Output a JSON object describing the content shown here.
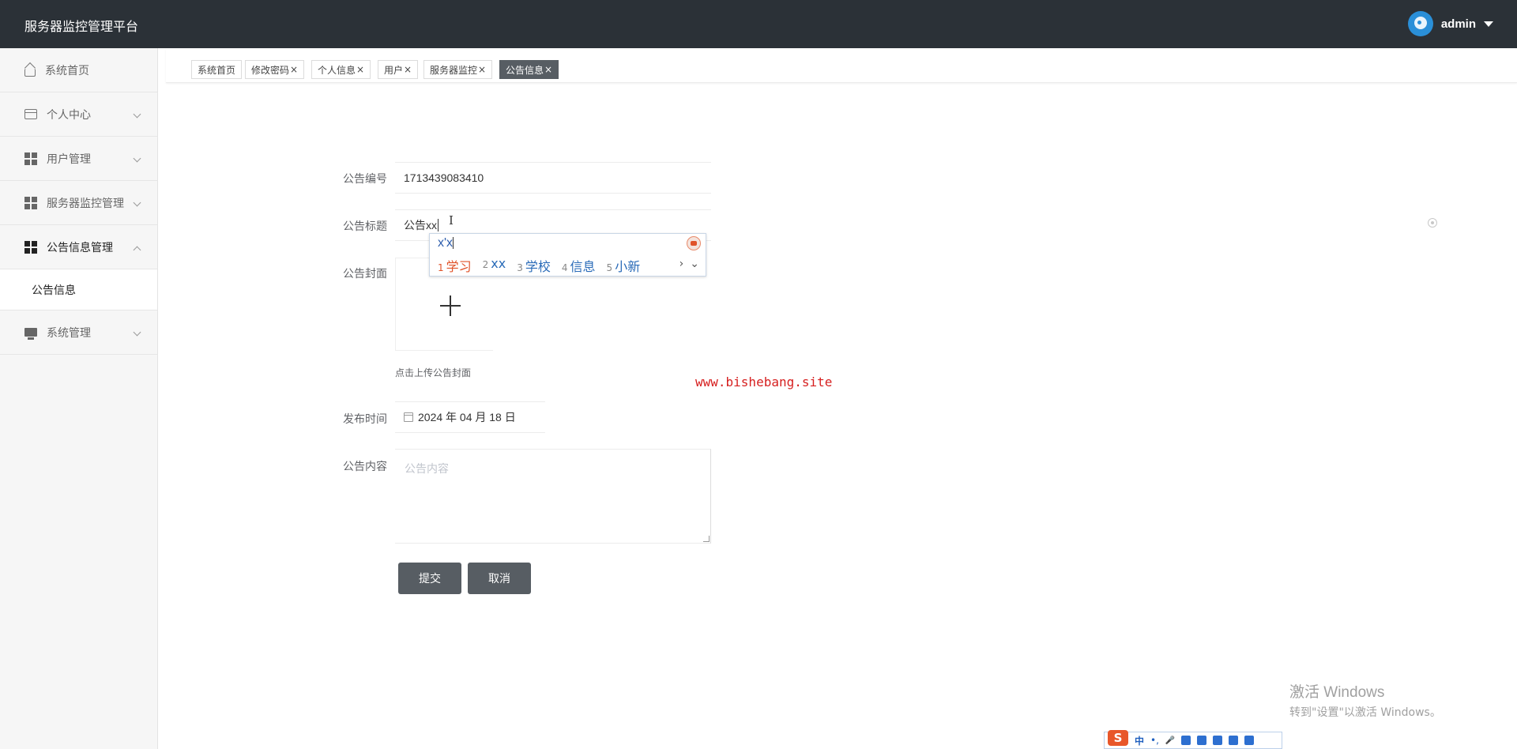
{
  "header": {
    "title": "服务器监控管理平台",
    "user": "admin"
  },
  "sidebar": {
    "items": [
      {
        "label": "系统首页",
        "icon": "home-icon"
      },
      {
        "label": "个人中心",
        "icon": "card-icon"
      },
      {
        "label": "用户管理",
        "icon": "grid-icon"
      },
      {
        "label": "服务器监控管理",
        "icon": "grid-icon"
      },
      {
        "label": "公告信息管理",
        "icon": "grid-icon"
      },
      {
        "label": "系统管理",
        "icon": "monitor-icon"
      }
    ],
    "submenu": {
      "label": "公告信息"
    }
  },
  "tabs": [
    {
      "label": "系统首页"
    },
    {
      "label": "修改密码"
    },
    {
      "label": "个人信息"
    },
    {
      "label": "用户"
    },
    {
      "label": "服务器监控"
    },
    {
      "label": "公告信息"
    }
  ],
  "tab_close": "×",
  "form": {
    "number": {
      "label": "公告编号",
      "value": "1713439083410"
    },
    "title": {
      "label": "公告标题",
      "value": "公告xx"
    },
    "cover": {
      "label": "公告封面",
      "hint": "点击上传公告封面"
    },
    "date": {
      "label": "发布时间",
      "value": "2024 年 04 月 18 日"
    },
    "content": {
      "label": "公告内容",
      "placeholder": "公告内容"
    },
    "submit": "提交",
    "cancel": "取消"
  },
  "ime": {
    "input": "x'x",
    "candidates": [
      {
        "num": "1",
        "text": "学习"
      },
      {
        "num": "2",
        "text": "xx"
      },
      {
        "num": "3",
        "text": "学校"
      },
      {
        "num": "4",
        "text": "信息"
      },
      {
        "num": "5",
        "text": "小新"
      }
    ],
    "next": "›",
    "expand": "⌄"
  },
  "watermark": "www.bishebang.site",
  "windows_activation": {
    "line1": "激活 Windows",
    "line2": "转到\"设置\"以激活 Windows。"
  },
  "ime_toolbar": {
    "logo": "S",
    "mode": "中",
    "punct": "•,",
    "mic": "🎤"
  },
  "colors": {
    "header_bg": "#2b3137",
    "active_tab": "#575d63",
    "button": "#575d63",
    "watermark": "#d62020"
  }
}
